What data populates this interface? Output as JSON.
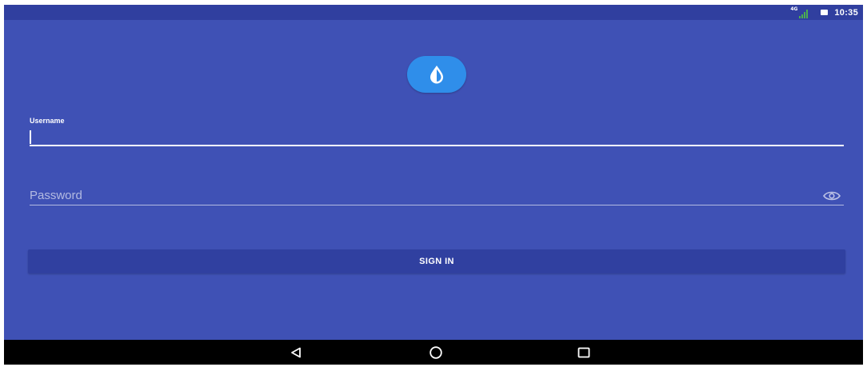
{
  "status_bar": {
    "network_label": "4G",
    "time": "10:35"
  },
  "app": {
    "logo_icon": "drop-half-icon"
  },
  "login": {
    "username_label": "Username",
    "username_value": "",
    "password_placeholder": "Password",
    "password_value": "",
    "password_toggle_icon": "eye-icon",
    "signin_label": "SIGN IN"
  },
  "nav": {
    "back_icon": "back-triangle-icon",
    "home_icon": "home-circle-icon",
    "recents_icon": "recents-square-icon"
  },
  "colors": {
    "primary": "#3F51B5",
    "primary_dark": "#303F9F",
    "logo_blue": "#2F8EEA",
    "signal_green": "#4CAF50",
    "button": "#3040A0"
  }
}
